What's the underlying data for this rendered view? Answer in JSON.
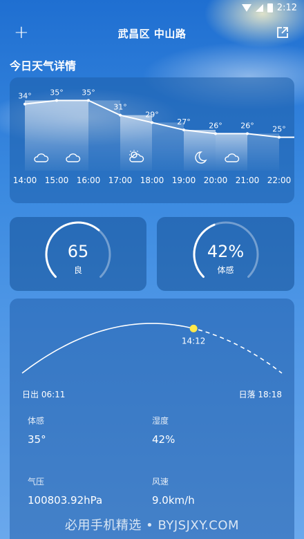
{
  "status_bar": {
    "time": "2:12"
  },
  "header": {
    "add_label": "+",
    "title": "武昌区  中山路"
  },
  "section_title": "今日天气详情",
  "hourly": [
    {
      "time": "14:00",
      "temp": "34°",
      "icon": "cloudy-icon"
    },
    {
      "time": "15:00",
      "temp": "35°",
      "icon": "cloudy-icon"
    },
    {
      "time": "16:00",
      "temp": "35°",
      "icon": ""
    },
    {
      "time": "17:00",
      "temp": "31°",
      "icon": "partly-cloudy-icon"
    },
    {
      "time": "18:00",
      "temp": "29°",
      "icon": ""
    },
    {
      "time": "19:00",
      "temp": "27°",
      "icon": "moon-icon"
    },
    {
      "time": "20:00",
      "temp": "26°",
      "icon": "cloudy-icon"
    },
    {
      "time": "21:00",
      "temp": "26°",
      "icon": ""
    },
    {
      "time": "22:00",
      "temp": "25°",
      "icon": ""
    }
  ],
  "aqi": {
    "value": "65",
    "label": "良",
    "fraction": 0.65
  },
  "humidity_gauge": {
    "value": "42%",
    "label": "体感",
    "fraction": 0.42
  },
  "sun": {
    "sunrise": "日出 06:11",
    "sunset": "日落 18:18",
    "current_time": "14:12",
    "progress": 0.66
  },
  "details": [
    {
      "key": "体感",
      "value": "35°"
    },
    {
      "key": "湿度",
      "value": "42%"
    },
    {
      "key": "气压",
      "value": "100803.92hPa"
    },
    {
      "key": "风速",
      "value": "9.0km/h"
    }
  ],
  "watermark": "必用手机精选 • BYJSJXY.COM",
  "colors": {
    "sun_dot": "#FFE94A",
    "line": "#FFFFFF"
  }
}
